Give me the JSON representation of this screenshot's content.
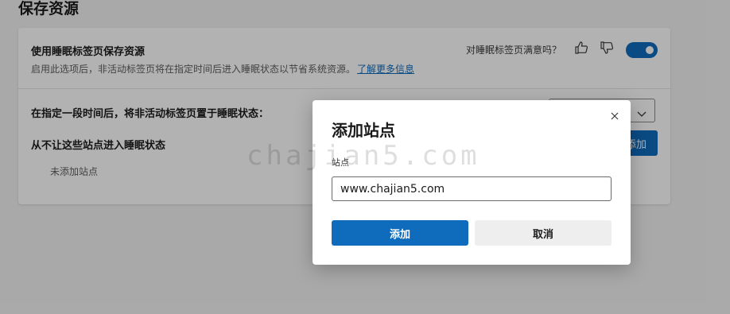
{
  "page": {
    "title": "保存资源"
  },
  "sleeping_tabs": {
    "title": "使用睡眠标签页保存资源",
    "description": "启用此选项后，非活动标签页将在指定时间后进入睡眠状态以节省系统资源。",
    "learn_more": "了解更多信息",
    "feedback_question": "对睡眠标签页满意吗？",
    "thumbs_up_icon": "thumbs-up-icon",
    "thumbs_down_icon": "thumbs-down-icon",
    "enabled": true,
    "accent_color": "#0f6cbd"
  },
  "timeout": {
    "label": "在指定一段时间后，将非活动标签页置于睡眠状态："
  },
  "exceptions": {
    "label": "从不让这些站点进入睡眠状态",
    "add_button": "添加",
    "empty_text": "未添加站点"
  },
  "dialog": {
    "title": "添加站点",
    "field_label": "站点",
    "input_value": "www.chajian5.com",
    "add_button": "添加",
    "cancel_button": "取消"
  },
  "watermark": "chajian5.com"
}
